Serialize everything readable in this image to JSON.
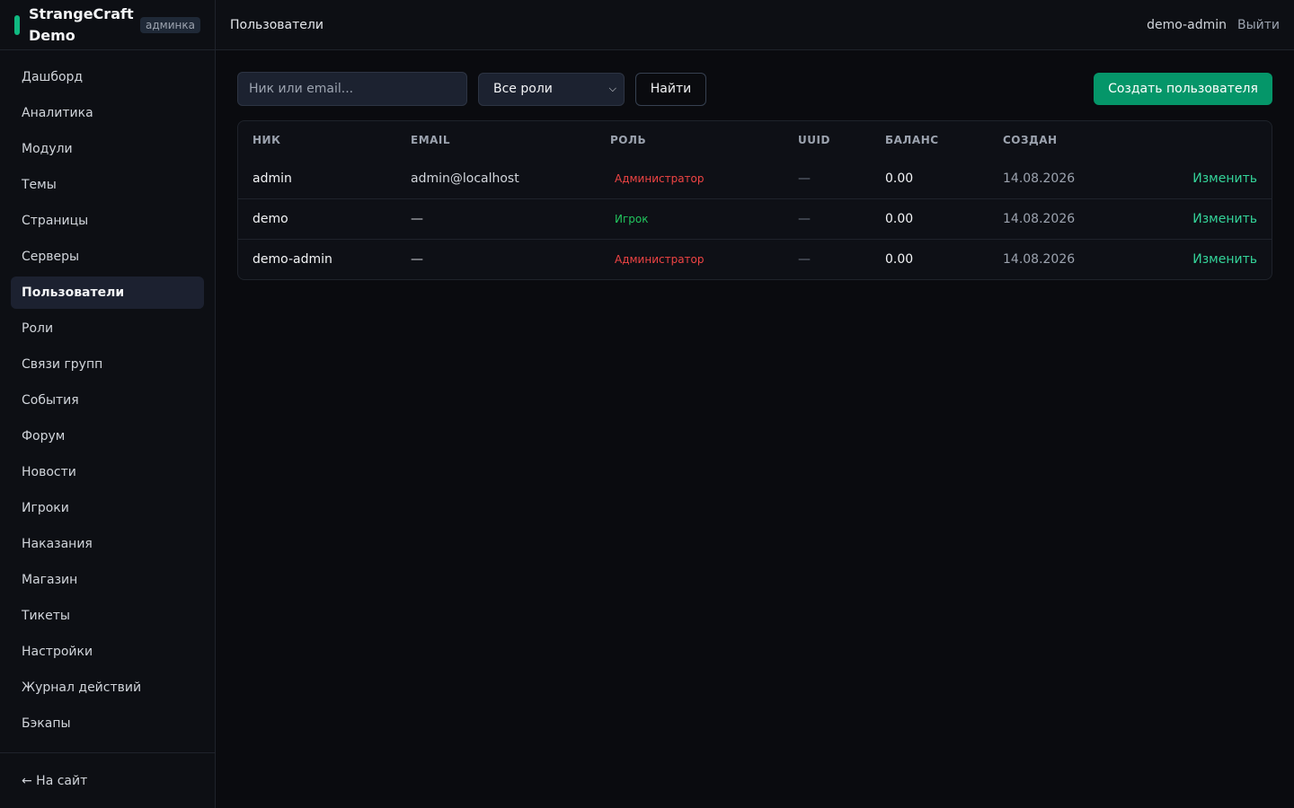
{
  "brand": {
    "name": "StrangeCraft Demo",
    "badge": "админка",
    "accent": "#10b981"
  },
  "sidebar": {
    "items": [
      {
        "label": "Дашборд"
      },
      {
        "label": "Аналитика"
      },
      {
        "label": "Модули"
      },
      {
        "label": "Темы"
      },
      {
        "label": "Страницы"
      },
      {
        "label": "Серверы"
      },
      {
        "label": "Пользователи",
        "active": true
      },
      {
        "label": "Роли"
      },
      {
        "label": "Связи групп"
      },
      {
        "label": "События"
      },
      {
        "label": "Форум"
      },
      {
        "label": "Новости"
      },
      {
        "label": "Игроки"
      },
      {
        "label": "Наказания"
      },
      {
        "label": "Магазин"
      },
      {
        "label": "Тикеты"
      },
      {
        "label": "Настройки"
      },
      {
        "label": "Журнал действий"
      },
      {
        "label": "Бэкапы"
      }
    ],
    "footer_link": "← На сайт"
  },
  "topbar": {
    "title": "Пользователи",
    "user": "demo-admin",
    "logout": "Выйти"
  },
  "toolbar": {
    "search_placeholder": "Ник или email...",
    "role_filter": "Все роли",
    "find_label": "Найти",
    "create_label": "Создать пользователя"
  },
  "table": {
    "headers": [
      "НИК",
      "EMAIL",
      "РОЛЬ",
      "UUID",
      "БАЛАНС",
      "СОЗДАН"
    ],
    "rows": [
      {
        "nick": "admin",
        "email": "admin@localhost",
        "role": "Администратор",
        "role_type": "admin",
        "uuid": "—",
        "balance": "0.00",
        "created": "14.08.2026",
        "action": "Изменить"
      },
      {
        "nick": "demo",
        "email": "—",
        "role": "Игрок",
        "role_type": "player",
        "uuid": "—",
        "balance": "0.00",
        "created": "14.08.2026",
        "action": "Изменить"
      },
      {
        "nick": "demo-admin",
        "email": "—",
        "role": "Администратор",
        "role_type": "admin",
        "uuid": "—",
        "balance": "0.00",
        "created": "14.08.2026",
        "action": "Изменить"
      }
    ]
  },
  "colors": {
    "primary": "#059669",
    "admin_role": "#ef4444",
    "player_role": "#22c55e",
    "link": "#34d399"
  }
}
